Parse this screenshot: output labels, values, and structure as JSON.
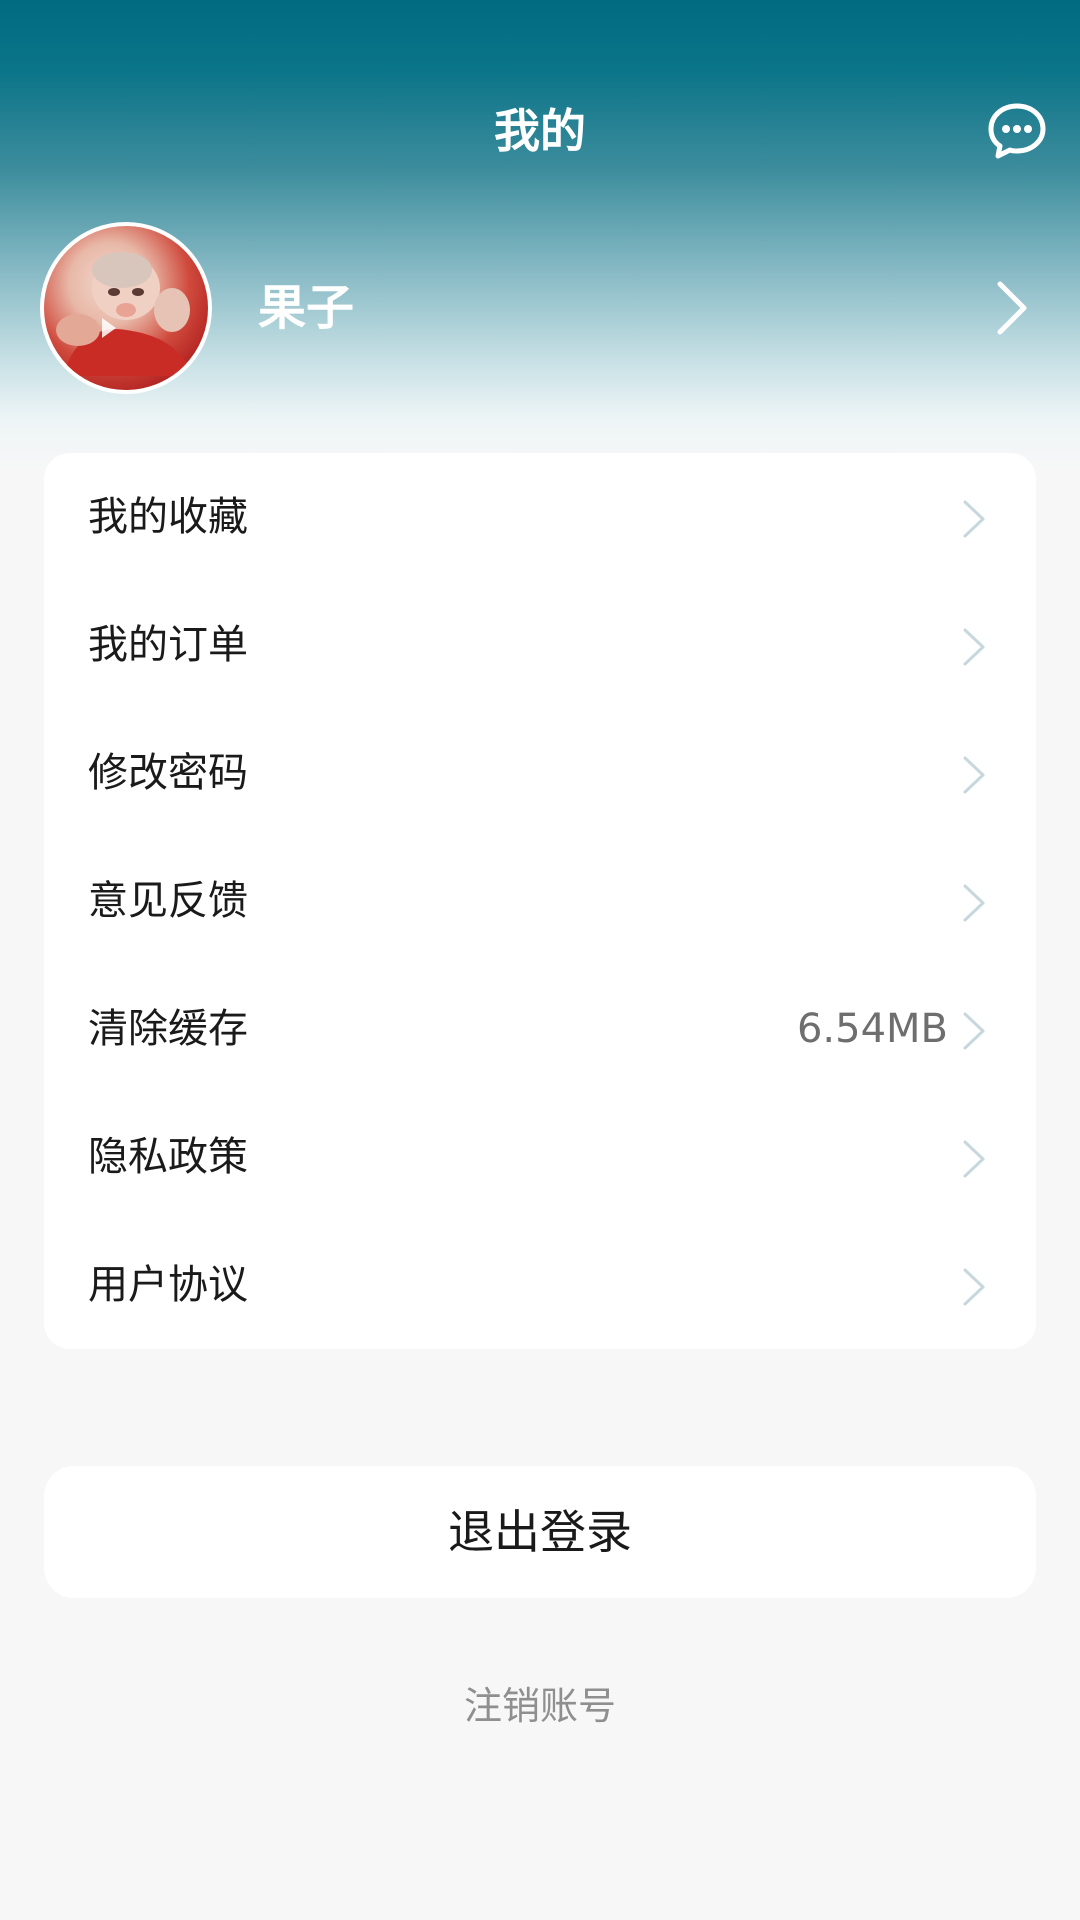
{
  "header": {
    "title": "我的",
    "message_icon": "chat-bubble-icon"
  },
  "profile": {
    "username": "果子",
    "avatar": "user-avatar-photo",
    "chevron_icon": "chevron-right-icon"
  },
  "menu": {
    "items": [
      {
        "label": "我的收藏",
        "value": ""
      },
      {
        "label": "我的订单",
        "value": ""
      },
      {
        "label": "修改密码",
        "value": ""
      },
      {
        "label": "意见反馈",
        "value": ""
      },
      {
        "label": "清除缓存",
        "value": "6.54MB"
      },
      {
        "label": "隐私政策",
        "value": ""
      },
      {
        "label": "用户协议",
        "value": ""
      }
    ]
  },
  "actions": {
    "logout_label": "退出登录",
    "cancel_account_label": "注销账号"
  },
  "colors": {
    "header_top": "#006b82",
    "page_background": "#f7f7f7",
    "card_background": "#ffffff"
  }
}
